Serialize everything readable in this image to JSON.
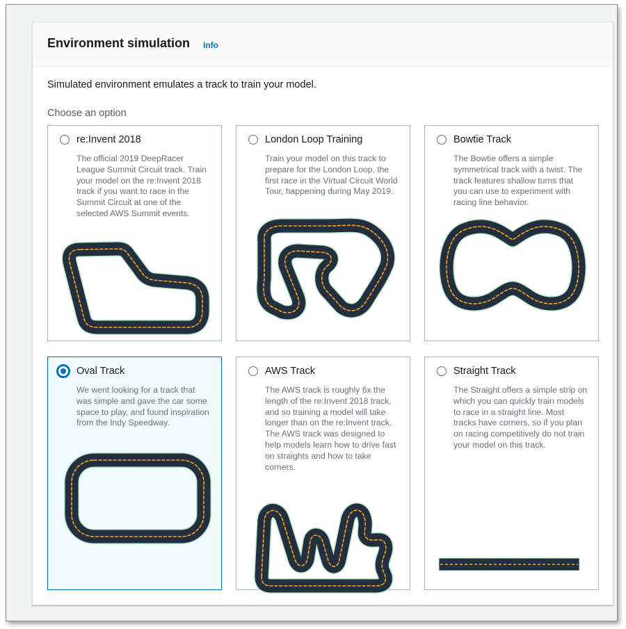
{
  "section": {
    "title": "Environment simulation",
    "info_link": "Info",
    "description": "Simulated environment emulates a track to train your model.",
    "choose_label": "Choose an option"
  },
  "tracks": [
    {
      "name": "re:Invent 2018",
      "description": "The official 2019 DeepRacer League Summit Circuit track. Train your model on the re:Invent 2018 track if you want to race in the Summit Circuit at one of the selected AWS Summit events.",
      "selected": false,
      "icon": "reinvent-2018-track-icon"
    },
    {
      "name": "London Loop Training",
      "description": "Train your model on this track to prepare for the London Loop, the first race in the Virtual Circuit World Tour, happening during May 2019.",
      "selected": false,
      "icon": "london-loop-track-icon"
    },
    {
      "name": "Bowtie Track",
      "description": "The Bowtie offers a simple symmetrical track with a twist. The track features shallow turns that you can use to experiment with racing line behavior.",
      "selected": false,
      "icon": "bowtie-track-icon"
    },
    {
      "name": "Oval Track",
      "description": "We went looking for a track that was simple and gave the car some space to play, and found inspiration from the Indy Speedway.",
      "selected": true,
      "icon": "oval-track-icon"
    },
    {
      "name": "AWS Track",
      "description": "The AWS track is roughly 6x the length of the re:Invent 2018 track, and so training a model will take longer than on the re:Invent track. The AWS track was designed to help models learn how to drive fast on straights and how to take corners.",
      "selected": false,
      "icon": "aws-track-icon"
    },
    {
      "name": "Straight Track",
      "description": "The Straight offers a simple strip on which you can quickly train models to race in a straight line. Most tracks have corners, so if you plan on racing competitively do not train your model on this track.",
      "selected": false,
      "icon": "straight-track-icon"
    }
  ],
  "colors": {
    "accent": "#0073bb",
    "track_surface": "#232f3e",
    "track_center_line": "#f7a81b",
    "track_edge": "#b8e6c8"
  }
}
